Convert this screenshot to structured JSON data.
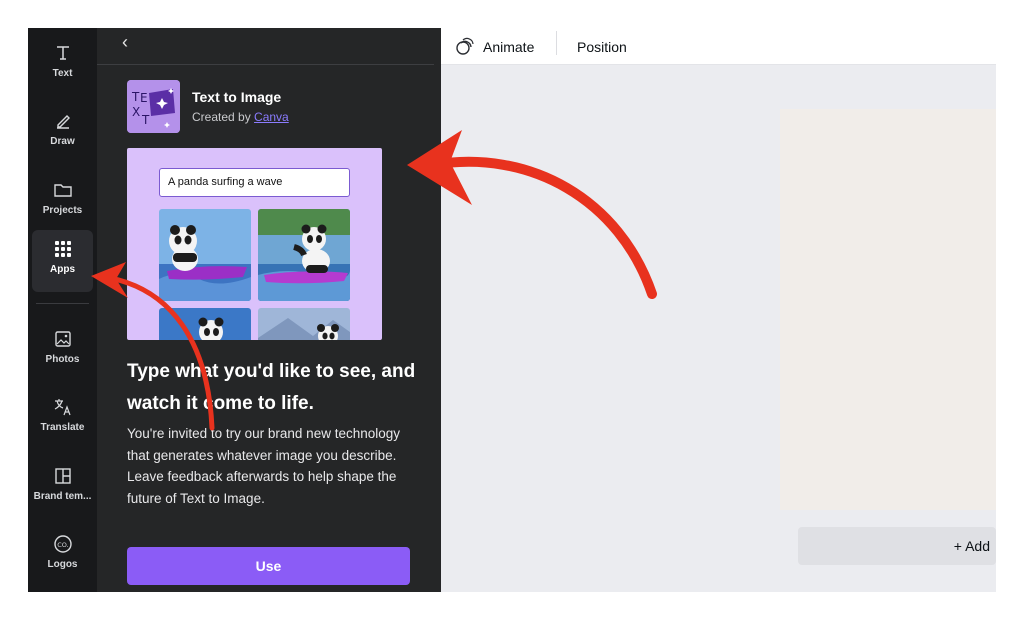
{
  "rail": {
    "items": [
      {
        "label": "Text"
      },
      {
        "label": "Draw"
      },
      {
        "label": "Projects"
      },
      {
        "label": "Apps"
      },
      {
        "label": "Photos"
      },
      {
        "label": "Translate"
      },
      {
        "label": "Brand tem..."
      },
      {
        "label": "Logos"
      }
    ],
    "active": "Apps"
  },
  "panel": {
    "back_icon": "chevron-left-icon",
    "app": {
      "title": "Text to Image",
      "created_by": "Created by ",
      "author": "Canva",
      "logo_letters": "TE XT"
    },
    "preview": {
      "prompt": "A panda surfing a wave"
    },
    "headline": "Type what you'd like to see, and watch it come to life.",
    "description": "You're invited to try our brand new technology that generates whatever image you describe. Leave feedback afterwards to help shape the future of Text to Image.",
    "use_label": "Use",
    "accent": "#8b5cf6"
  },
  "toolbar": {
    "animate_label": "Animate",
    "position_label": "Position"
  },
  "canvas": {
    "add_page_label": "+ Add"
  },
  "annotations": {
    "arrow_color": "#e8321e"
  }
}
